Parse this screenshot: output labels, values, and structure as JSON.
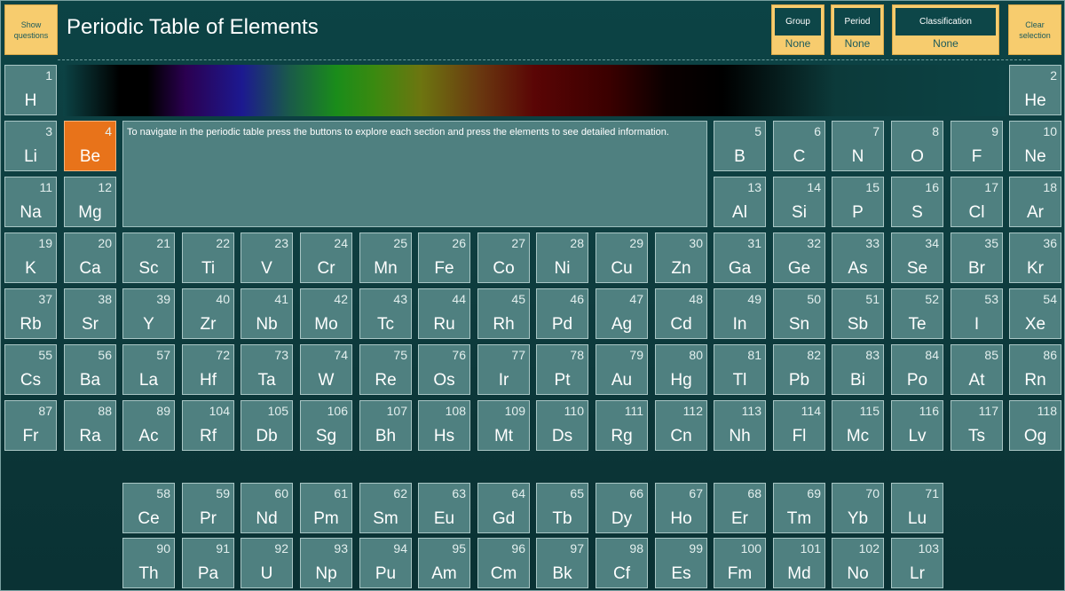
{
  "header": {
    "show_questions_label": "Show questions",
    "title": "Periodic Table of Elements",
    "clear_selection_label": "Clear selection",
    "filters": [
      {
        "label": "Group",
        "value": "None"
      },
      {
        "label": "Period",
        "value": "None"
      },
      {
        "label": "Classification",
        "value": "None"
      }
    ]
  },
  "info_text": "To navigate in the periodic table press the buttons to explore each section and press the elements to see detailed information.",
  "colors": {
    "tile": "#4f8080",
    "selected": "#e8731a",
    "button": "#f7cc6e",
    "background": "#0c4345"
  },
  "selected_element": "Be",
  "elements": [
    {
      "n": "1",
      "s": "H",
      "row": 0,
      "col": 0
    },
    {
      "n": "2",
      "s": "He",
      "row": 0,
      "col": 17
    },
    {
      "n": "3",
      "s": "Li",
      "row": 1,
      "col": 0
    },
    {
      "n": "4",
      "s": "Be",
      "row": 1,
      "col": 1
    },
    {
      "n": "5",
      "s": "B",
      "row": 1,
      "col": 12
    },
    {
      "n": "6",
      "s": "C",
      "row": 1,
      "col": 13
    },
    {
      "n": "7",
      "s": "N",
      "row": 1,
      "col": 14
    },
    {
      "n": "8",
      "s": "O",
      "row": 1,
      "col": 15
    },
    {
      "n": "9",
      "s": "F",
      "row": 1,
      "col": 16
    },
    {
      "n": "10",
      "s": "Ne",
      "row": 1,
      "col": 17
    },
    {
      "n": "11",
      "s": "Na",
      "row": 2,
      "col": 0
    },
    {
      "n": "12",
      "s": "Mg",
      "row": 2,
      "col": 1
    },
    {
      "n": "13",
      "s": "Al",
      "row": 2,
      "col": 12
    },
    {
      "n": "14",
      "s": "Si",
      "row": 2,
      "col": 13
    },
    {
      "n": "15",
      "s": "P",
      "row": 2,
      "col": 14
    },
    {
      "n": "16",
      "s": "S",
      "row": 2,
      "col": 15
    },
    {
      "n": "17",
      "s": "Cl",
      "row": 2,
      "col": 16
    },
    {
      "n": "18",
      "s": "Ar",
      "row": 2,
      "col": 17
    },
    {
      "n": "19",
      "s": "K",
      "row": 3,
      "col": 0
    },
    {
      "n": "20",
      "s": "Ca",
      "row": 3,
      "col": 1
    },
    {
      "n": "21",
      "s": "Sc",
      "row": 3,
      "col": 2
    },
    {
      "n": "22",
      "s": "Ti",
      "row": 3,
      "col": 3
    },
    {
      "n": "23",
      "s": "V",
      "row": 3,
      "col": 4
    },
    {
      "n": "24",
      "s": "Cr",
      "row": 3,
      "col": 5
    },
    {
      "n": "25",
      "s": "Mn",
      "row": 3,
      "col": 6
    },
    {
      "n": "26",
      "s": "Fe",
      "row": 3,
      "col": 7
    },
    {
      "n": "27",
      "s": "Co",
      "row": 3,
      "col": 8
    },
    {
      "n": "28",
      "s": "Ni",
      "row": 3,
      "col": 9
    },
    {
      "n": "29",
      "s": "Cu",
      "row": 3,
      "col": 10
    },
    {
      "n": "30",
      "s": "Zn",
      "row": 3,
      "col": 11
    },
    {
      "n": "31",
      "s": "Ga",
      "row": 3,
      "col": 12
    },
    {
      "n": "32",
      "s": "Ge",
      "row": 3,
      "col": 13
    },
    {
      "n": "33",
      "s": "As",
      "row": 3,
      "col": 14
    },
    {
      "n": "34",
      "s": "Se",
      "row": 3,
      "col": 15
    },
    {
      "n": "35",
      "s": "Br",
      "row": 3,
      "col": 16
    },
    {
      "n": "36",
      "s": "Kr",
      "row": 3,
      "col": 17
    },
    {
      "n": "37",
      "s": "Rb",
      "row": 4,
      "col": 0
    },
    {
      "n": "38",
      "s": "Sr",
      "row": 4,
      "col": 1
    },
    {
      "n": "39",
      "s": "Y",
      "row": 4,
      "col": 2
    },
    {
      "n": "40",
      "s": "Zr",
      "row": 4,
      "col": 3
    },
    {
      "n": "41",
      "s": "Nb",
      "row": 4,
      "col": 4
    },
    {
      "n": "42",
      "s": "Mo",
      "row": 4,
      "col": 5
    },
    {
      "n": "43",
      "s": "Tc",
      "row": 4,
      "col": 6
    },
    {
      "n": "44",
      "s": "Ru",
      "row": 4,
      "col": 7
    },
    {
      "n": "45",
      "s": "Rh",
      "row": 4,
      "col": 8
    },
    {
      "n": "46",
      "s": "Pd",
      "row": 4,
      "col": 9
    },
    {
      "n": "47",
      "s": "Ag",
      "row": 4,
      "col": 10
    },
    {
      "n": "48",
      "s": "Cd",
      "row": 4,
      "col": 11
    },
    {
      "n": "49",
      "s": "In",
      "row": 4,
      "col": 12
    },
    {
      "n": "50",
      "s": "Sn",
      "row": 4,
      "col": 13
    },
    {
      "n": "51",
      "s": "Sb",
      "row": 4,
      "col": 14
    },
    {
      "n": "52",
      "s": "Te",
      "row": 4,
      "col": 15
    },
    {
      "n": "53",
      "s": "I",
      "row": 4,
      "col": 16
    },
    {
      "n": "54",
      "s": "Xe",
      "row": 4,
      "col": 17
    },
    {
      "n": "55",
      "s": "Cs",
      "row": 5,
      "col": 0
    },
    {
      "n": "56",
      "s": "Ba",
      "row": 5,
      "col": 1
    },
    {
      "n": "57",
      "s": "La",
      "row": 5,
      "col": 2
    },
    {
      "n": "72",
      "s": "Hf",
      "row": 5,
      "col": 3
    },
    {
      "n": "73",
      "s": "Ta",
      "row": 5,
      "col": 4
    },
    {
      "n": "74",
      "s": "W",
      "row": 5,
      "col": 5
    },
    {
      "n": "75",
      "s": "Re",
      "row": 5,
      "col": 6
    },
    {
      "n": "76",
      "s": "Os",
      "row": 5,
      "col": 7
    },
    {
      "n": "77",
      "s": "Ir",
      "row": 5,
      "col": 8
    },
    {
      "n": "78",
      "s": "Pt",
      "row": 5,
      "col": 9
    },
    {
      "n": "79",
      "s": "Au",
      "row": 5,
      "col": 10
    },
    {
      "n": "80",
      "s": "Hg",
      "row": 5,
      "col": 11
    },
    {
      "n": "81",
      "s": "Tl",
      "row": 5,
      "col": 12
    },
    {
      "n": "82",
      "s": "Pb",
      "row": 5,
      "col": 13
    },
    {
      "n": "83",
      "s": "Bi",
      "row": 5,
      "col": 14
    },
    {
      "n": "84",
      "s": "Po",
      "row": 5,
      "col": 15
    },
    {
      "n": "85",
      "s": "At",
      "row": 5,
      "col": 16
    },
    {
      "n": "86",
      "s": "Rn",
      "row": 5,
      "col": 17
    },
    {
      "n": "87",
      "s": "Fr",
      "row": 6,
      "col": 0
    },
    {
      "n": "88",
      "s": "Ra",
      "row": 6,
      "col": 1
    },
    {
      "n": "89",
      "s": "Ac",
      "row": 6,
      "col": 2
    },
    {
      "n": "104",
      "s": "Rf",
      "row": 6,
      "col": 3
    },
    {
      "n": "105",
      "s": "Db",
      "row": 6,
      "col": 4
    },
    {
      "n": "106",
      "s": "Sg",
      "row": 6,
      "col": 5
    },
    {
      "n": "107",
      "s": "Bh",
      "row": 6,
      "col": 6
    },
    {
      "n": "108",
      "s": "Hs",
      "row": 6,
      "col": 7
    },
    {
      "n": "109",
      "s": "Mt",
      "row": 6,
      "col": 8
    },
    {
      "n": "110",
      "s": "Ds",
      "row": 6,
      "col": 9
    },
    {
      "n": "111",
      "s": "Rg",
      "row": 6,
      "col": 10
    },
    {
      "n": "112",
      "s": "Cn",
      "row": 6,
      "col": 11
    },
    {
      "n": "113",
      "s": "Nh",
      "row": 6,
      "col": 12
    },
    {
      "n": "114",
      "s": "Fl",
      "row": 6,
      "col": 13
    },
    {
      "n": "115",
      "s": "Mc",
      "row": 6,
      "col": 14
    },
    {
      "n": "116",
      "s": "Lv",
      "row": 6,
      "col": 15
    },
    {
      "n": "117",
      "s": "Ts",
      "row": 6,
      "col": 16
    },
    {
      "n": "118",
      "s": "Og",
      "row": 6,
      "col": 17
    },
    {
      "n": "58",
      "s": "Ce",
      "row": 7,
      "col": 2
    },
    {
      "n": "59",
      "s": "Pr",
      "row": 7,
      "col": 3
    },
    {
      "n": "60",
      "s": "Nd",
      "row": 7,
      "col": 4
    },
    {
      "n": "61",
      "s": "Pm",
      "row": 7,
      "col": 5
    },
    {
      "n": "62",
      "s": "Sm",
      "row": 7,
      "col": 6
    },
    {
      "n": "63",
      "s": "Eu",
      "row": 7,
      "col": 7
    },
    {
      "n": "64",
      "s": "Gd",
      "row": 7,
      "col": 8
    },
    {
      "n": "65",
      "s": "Tb",
      "row": 7,
      "col": 9
    },
    {
      "n": "66",
      "s": "Dy",
      "row": 7,
      "col": 10
    },
    {
      "n": "67",
      "s": "Ho",
      "row": 7,
      "col": 11
    },
    {
      "n": "68",
      "s": "Er",
      "row": 7,
      "col": 12
    },
    {
      "n": "69",
      "s": "Tm",
      "row": 7,
      "col": 13
    },
    {
      "n": "70",
      "s": "Yb",
      "row": 7,
      "col": 14
    },
    {
      "n": "71",
      "s": "Lu",
      "row": 7,
      "col": 15
    },
    {
      "n": "90",
      "s": "Th",
      "row": 8,
      "col": 2
    },
    {
      "n": "91",
      "s": "Pa",
      "row": 8,
      "col": 3
    },
    {
      "n": "92",
      "s": "U",
      "row": 8,
      "col": 4
    },
    {
      "n": "93",
      "s": "Np",
      "row": 8,
      "col": 5
    },
    {
      "n": "94",
      "s": "Pu",
      "row": 8,
      "col": 6
    },
    {
      "n": "95",
      "s": "Am",
      "row": 8,
      "col": 7
    },
    {
      "n": "96",
      "s": "Cm",
      "row": 8,
      "col": 8
    },
    {
      "n": "97",
      "s": "Bk",
      "row": 8,
      "col": 9
    },
    {
      "n": "98",
      "s": "Cf",
      "row": 8,
      "col": 10
    },
    {
      "n": "99",
      "s": "Es",
      "row": 8,
      "col": 11
    },
    {
      "n": "100",
      "s": "Fm",
      "row": 8,
      "col": 12
    },
    {
      "n": "101",
      "s": "Md",
      "row": 8,
      "col": 13
    },
    {
      "n": "102",
      "s": "No",
      "row": 8,
      "col": 14
    },
    {
      "n": "103",
      "s": "Lr",
      "row": 8,
      "col": 15
    }
  ]
}
